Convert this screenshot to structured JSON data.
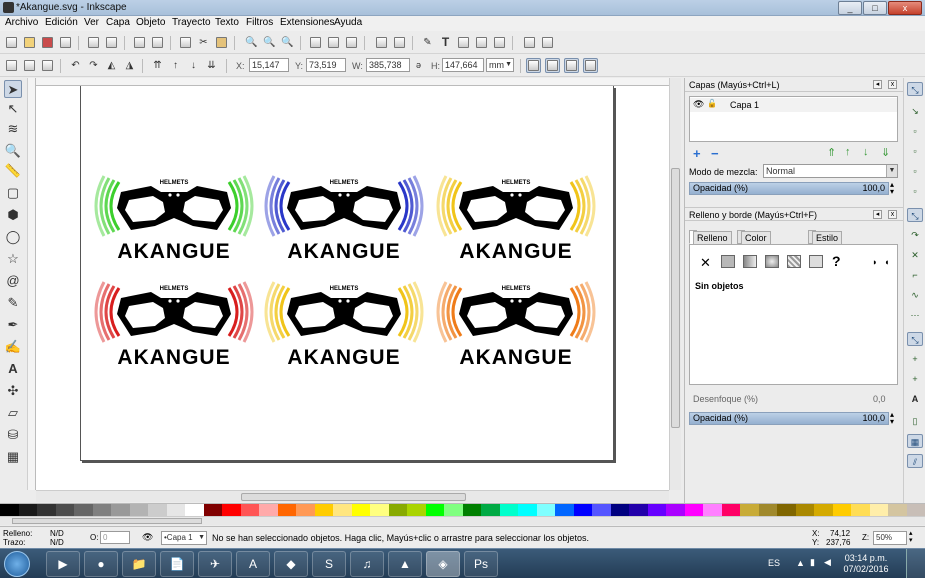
{
  "window": {
    "title": "*Akangue.svg - Inkscape",
    "min": "_",
    "max": "□",
    "close": "x"
  },
  "menu": [
    "Archivo",
    "Edición",
    "Ver",
    "Capa",
    "Objeto",
    "Trayecto",
    "Texto",
    "Filtros",
    "Extensiones",
    "Ayuda"
  ],
  "selectbar": {
    "x_label": "X:",
    "x_value": "15,147",
    "y_label": "Y:",
    "y_value": "73,519",
    "w_label": "W:",
    "w_value": "385,738",
    "h_label": "H:",
    "h_value": "147,664",
    "unit": "mm"
  },
  "canvas": {
    "logos": [
      {
        "brand": "AKANGUE",
        "sub": "HELMETS",
        "color": "#3ccf2c"
      },
      {
        "brand": "AKANGUE",
        "sub": "HELMETS",
        "color": "#2a37c8"
      },
      {
        "brand": "AKANGUE",
        "sub": "HELMETS",
        "color": "#f0c419"
      },
      {
        "brand": "AKANGUE",
        "sub": "HELMETS",
        "color": "#d81e1e"
      },
      {
        "brand": "AKANGUE",
        "sub": "HELMETS",
        "color": "#f0c419"
      },
      {
        "brand": "AKANGUE",
        "sub": "HELMETS",
        "color": "#ef7c1a"
      }
    ]
  },
  "layers_panel": {
    "title": "Capas (Mayús+Ctrl+L)",
    "layer_name": "Capa 1",
    "blend_label": "Modo de mezcla:",
    "blend_value": "Normal",
    "opacity_label": "Opacidad (%)",
    "opacity_value": "100,0"
  },
  "fill_panel": {
    "title": "Relleno y borde (Mayús+Ctrl+F)",
    "tabs": [
      "Relleno",
      "Color de trazo",
      "Estilo de trazo"
    ],
    "no_objects": "Sin objetos",
    "blur_label": "Desenfoque (%)",
    "blur_value": "0,0",
    "opacity_label": "Opacidad (%)",
    "opacity_value": "100,0",
    "unknown_label": "?"
  },
  "status": {
    "fill_label": "Relleno:",
    "fill_value": "N/D",
    "stroke_label": "Trazo:",
    "stroke_value": "N/D",
    "opacity_label": "O:",
    "opacity_value": "0",
    "layer": "•Capa 1",
    "message": "No se han seleccionado objetos. Haga clic, Mayús+clic o arrastre para seleccionar los objetos.",
    "x_label": "X:",
    "x_value": "74,12",
    "y_label": "Y:",
    "y_value": "237,76",
    "zoom_label": "Z:",
    "zoom_value": "50%"
  },
  "palette": [
    "#000000",
    "#1a1a1a",
    "#333333",
    "#4d4d4d",
    "#666666",
    "#808080",
    "#999999",
    "#b3b3b3",
    "#cccccc",
    "#e6e6e6",
    "#ffffff",
    "#800000",
    "#ff0000",
    "#ff5555",
    "#ffaaaa",
    "#ff6600",
    "#ff9955",
    "#ffcc00",
    "#ffe680",
    "#ffff00",
    "#ffff80",
    "#88aa00",
    "#aad400",
    "#00ff00",
    "#80ff80",
    "#008000",
    "#00aa44",
    "#00ffcc",
    "#00ffff",
    "#80ffff",
    "#0066ff",
    "#0000ff",
    "#5555ff",
    "#000080",
    "#2200aa",
    "#6600ff",
    "#aa00ff",
    "#ff00ff",
    "#ff80ff",
    "#ff0066",
    "#c8ab37",
    "#a0892c",
    "#806600",
    "#aa8800",
    "#d4aa00",
    "#ffcc00",
    "#ffdd55",
    "#ffeeaa",
    "#d4c5a0",
    "#c8beb7"
  ],
  "taskbar": {
    "lang": "ES",
    "time": "03:14 p.m.",
    "date": "07/02/2016",
    "apps": [
      "▶",
      "●",
      "📁",
      "📄",
      "✈",
      "A",
      "◆",
      "S",
      "♫",
      "▲",
      "◈",
      "Ps"
    ]
  }
}
